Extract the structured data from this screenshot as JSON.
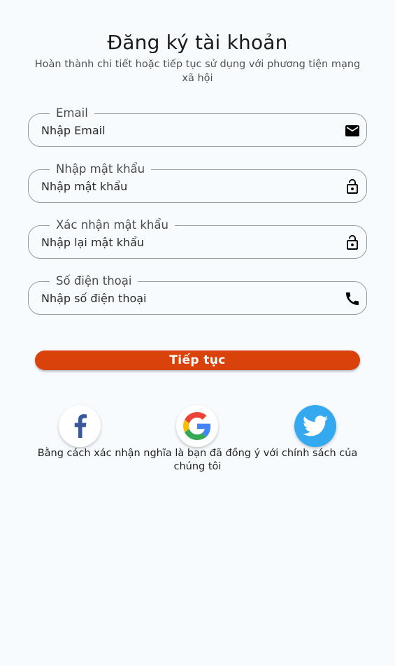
{
  "header": {
    "title": "Đăng ký tài khoản",
    "subtitle": "Hoàn thành chi tiết hoặc tiếp tục sử dụng với phương tiện mạng xã hội"
  },
  "form": {
    "email": {
      "label": "Email",
      "placeholder": "Nhập Email",
      "icon": "mail-icon"
    },
    "password": {
      "label": "Nhập mật khẩu",
      "placeholder": "Nhập mật khẩu",
      "icon": "lock-icon"
    },
    "confirm_password": {
      "label": "Xác nhận mật khẩu",
      "placeholder": "Nhập lại mật khẩu",
      "icon": "lock-icon"
    },
    "phone": {
      "label": "Số điện thoại",
      "placeholder": "Nhập số điện thoại",
      "icon": "phone-icon"
    }
  },
  "submit_label": "Tiếp tục",
  "social": [
    {
      "name": "facebook",
      "icon": "facebook-icon",
      "color": "#3b5998"
    },
    {
      "name": "google",
      "icon": "google-icon",
      "color": "#ffffff"
    },
    {
      "name": "twitter",
      "icon": "twitter-icon",
      "color": "#34a9f0"
    }
  ],
  "policy_text": "Bằng cách xác nhận nghĩa là bạn đã đồng ý với chính sách của chúng tôi",
  "colors": {
    "accent": "#d9420a",
    "background": "#f7fbfe",
    "border": "#9a9a9a"
  }
}
